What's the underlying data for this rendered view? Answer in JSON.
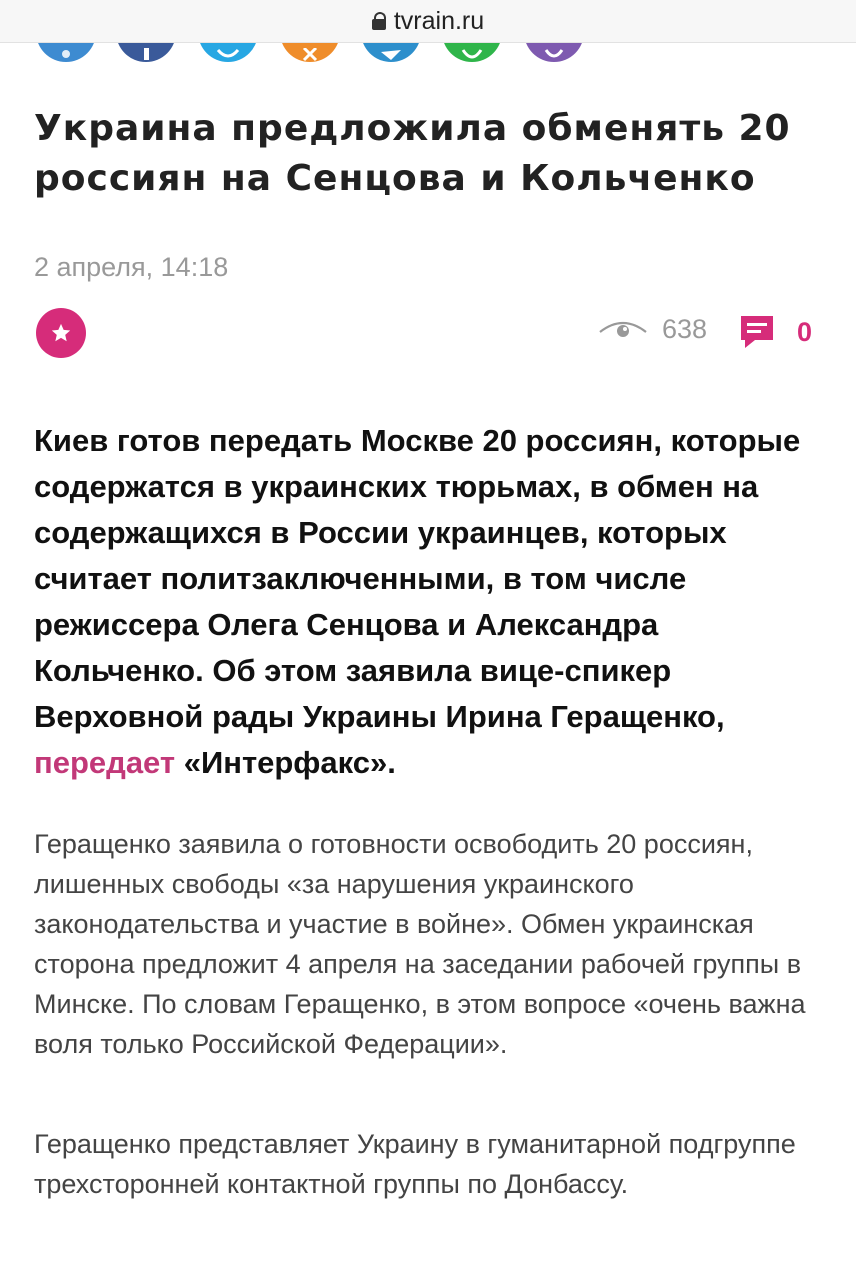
{
  "browser": {
    "url": "tvrain.ru"
  },
  "share": {
    "buttons": [
      {
        "name": "share-button-1",
        "color": "#3d8bd1",
        "icon": "share-icon"
      },
      {
        "name": "share-button-facebook",
        "color": "#3a5a9a",
        "icon": "facebook-icon"
      },
      {
        "name": "share-button-twitter",
        "color": "#27a7e3",
        "icon": "twitter-icon"
      },
      {
        "name": "share-button-odnoklassniki",
        "color": "#ef8d2b",
        "icon": "odnoklassniki-icon"
      },
      {
        "name": "share-button-telegram",
        "color": "#2d8fcc",
        "icon": "telegram-icon"
      },
      {
        "name": "share-button-whatsapp",
        "color": "#2fb54a",
        "icon": "whatsapp-icon"
      },
      {
        "name": "share-button-viber",
        "color": "#7e5ab0",
        "icon": "viber-icon"
      }
    ]
  },
  "article": {
    "title": "Украина предложила обменять 20 россиян на Сенцова и Кольченко",
    "date": "2 апреля, 14:18",
    "views": "638",
    "comments": "0",
    "lead_text": "Киев готов передать Москве 20 россиян, которые содержатся в украинских тюрьмах, в обмен на содержащихся в России украинцев, которых считает политзаключенными, в том числе режиссера Олега Сенцова и Александра Кольченко. Об этом заявила вице-спикер Верховной рады Украины Ирина Геращенко,",
    "lead_link": "передает",
    "lead_tail": "«Интерфакс».",
    "paragraphs": [
      "Геращенко заявила о готовности освободить 20 россиян, лишенных свободы «за нарушения украинского законодательства и участие в войне». Обмен украинская сторона предложит 4 апреля на заседании рабочей группы в Минске. По словам Геращенко, в этом вопросе «очень важна воля только Российской Федерации».",
      "Геращенко представляет Украину в гуманитарной подгруппе трехсторонней контактной группы по Донбассу."
    ],
    "accent_color": "#d62c7a"
  }
}
